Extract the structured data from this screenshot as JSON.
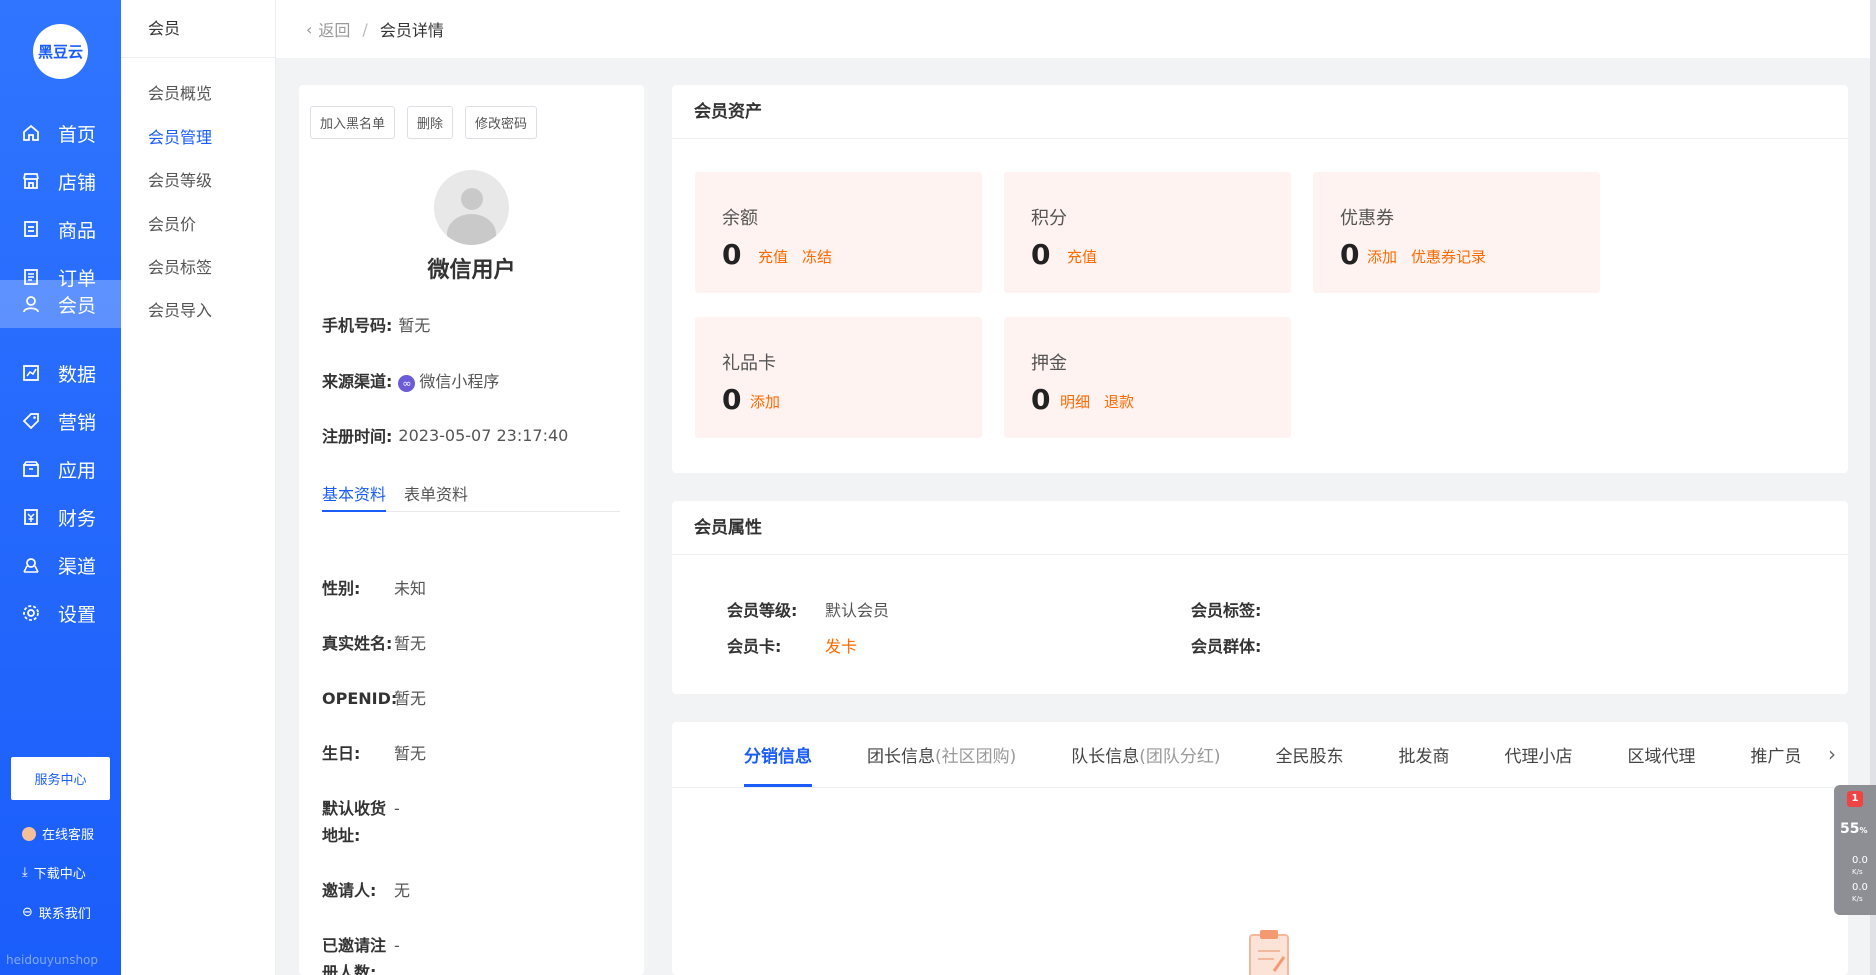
{
  "sidebar": {
    "logo_text": "黑豆云",
    "items": [
      {
        "label": "首页",
        "icon": "home-icon"
      },
      {
        "label": "店铺",
        "icon": "store-icon"
      },
      {
        "label": "商品",
        "icon": "product-icon"
      },
      {
        "label": "订单",
        "icon": "order-icon"
      },
      {
        "label": "会员",
        "icon": "user-icon"
      },
      {
        "label": "数据",
        "icon": "chart-icon"
      },
      {
        "label": "营销",
        "icon": "tag-icon"
      },
      {
        "label": "应用",
        "icon": "app-icon"
      },
      {
        "label": "财务",
        "icon": "finance-icon"
      },
      {
        "label": "渠道",
        "icon": "channel-icon"
      },
      {
        "label": "设置",
        "icon": "gear-icon"
      }
    ],
    "active_index": 4,
    "service_center": "服务中心",
    "online_service": "在线客服",
    "download_center": "下载中心",
    "contact_us": "联系我们",
    "brand_footer": "heidouyunshop"
  },
  "submenu": {
    "title": "会员",
    "items": [
      "会员概览",
      "会员管理",
      "会员等级",
      "会员价",
      "会员标签",
      "会员导入"
    ],
    "active_index": 1
  },
  "header": {
    "back": "返回",
    "separator": "/",
    "current": "会员详情"
  },
  "profile": {
    "buttons": {
      "blacklist": "加入黑名单",
      "delete": "删除",
      "change_password": "修改密码"
    },
    "nickname": "微信用户",
    "phone_label": "手机号码:",
    "phone_value": "暂无",
    "source_label": "来源渠道:",
    "source_value": "微信小程序",
    "register_label": "注册时间:",
    "register_value": "2023-05-07 23:17:40",
    "tabs": [
      "基本资料",
      "表单资料"
    ],
    "details": [
      {
        "label": "性别:",
        "value": "未知"
      },
      {
        "label": "真实姓名:",
        "value": "暂无"
      },
      {
        "label": "OPENID:",
        "value": "暂无"
      },
      {
        "label": "生日:",
        "value": "暂无"
      },
      {
        "label": "默认收货地址:",
        "value": "-"
      },
      {
        "label": "邀请人:",
        "value": "无"
      },
      {
        "label": "已邀请注册人数:",
        "value": "-"
      }
    ]
  },
  "assets": {
    "title": "会员资产",
    "items": [
      {
        "name": "余额",
        "value": "0",
        "links": [
          "充值",
          "冻结"
        ]
      },
      {
        "name": "积分",
        "value": "0",
        "links": [
          "充值"
        ]
      },
      {
        "name": "优惠券",
        "value": "0",
        "links": [
          "添加",
          "优惠券记录"
        ]
      },
      {
        "name": "礼品卡",
        "value": "0",
        "links": [
          "添加"
        ]
      },
      {
        "name": "押金",
        "value": "0",
        "links": [
          "明细",
          "退款"
        ]
      }
    ]
  },
  "attributes": {
    "title": "会员属性",
    "level_label": "会员等级:",
    "level_value": "默认会员",
    "card_label": "会员卡:",
    "card_value": "发卡",
    "tag_label": "会员标签:",
    "group_label": "会员群体:"
  },
  "distribution": {
    "tabs": [
      {
        "label": "分销信息",
        "sub": ""
      },
      {
        "label": "团长信息",
        "sub": "(社区团购)"
      },
      {
        "label": "队长信息",
        "sub": "(团队分红)"
      },
      {
        "label": "全民股东",
        "sub": ""
      },
      {
        "label": "批发商",
        "sub": ""
      },
      {
        "label": "代理小店",
        "sub": ""
      },
      {
        "label": "区域代理",
        "sub": ""
      },
      {
        "label": "推广员",
        "sub": ""
      }
    ],
    "active_index": 0
  },
  "widget": {
    "badge": "1",
    "percent": "55",
    "percent_unit": "%",
    "up": "0.0",
    "down": "0.0",
    "unit": "K/s"
  },
  "colors": {
    "primary": "#1a5dfb",
    "accent": "#ff6a00",
    "asset_bg": "#fff3f2"
  }
}
